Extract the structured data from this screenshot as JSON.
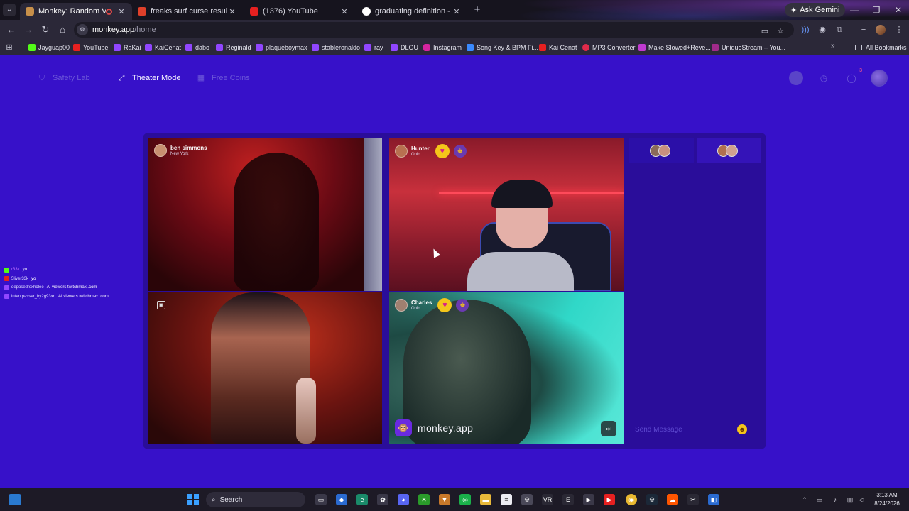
{
  "browser": {
    "tabs": [
      {
        "title": "Monkey: Random Video Ch",
        "active": true
      },
      {
        "title": "freaks surf curse results on Sou",
        "active": false
      },
      {
        "title": "(1376) YouTube",
        "active": false
      },
      {
        "title": "graduating definition - Google",
        "active": false
      }
    ],
    "ask_gemini": "Ask Gemini",
    "url_host": "monkey.app",
    "url_path": "/home",
    "bookmarks": [
      "Jayguap00",
      "YouTube",
      "RaKai",
      "KaiCenat",
      "dabo",
      "Reginald",
      "plaqueboymax",
      "stableronaldo",
      "ray",
      "DLOU",
      "Instagram",
      "Song Key & BPM Fi...",
      "Kai Cenat",
      "MP3 Converter",
      "Make Slowed+Reve...",
      "UniqueStream – You..."
    ],
    "all_bookmarks": "All Bookmarks"
  },
  "page": {
    "nav": {
      "safety_lab": "Safety Lab",
      "theater_mode": "Theater Mode",
      "free_coins": "Free Coins"
    },
    "notifications_badge": "3",
    "tiles": [
      {
        "name": "ben simmons",
        "location": "New York"
      },
      {
        "name": "Hunter",
        "location": "Ohio"
      },
      {
        "name": "",
        "location": ""
      },
      {
        "name": "Charles",
        "location": "Ohio"
      }
    ],
    "brand": "monkey.app",
    "message_placeholder": "Send Message",
    "chat": [
      {
        "user": "r33k",
        "text": "yo"
      },
      {
        "user": "5liver33k",
        "text": "yo"
      },
      {
        "user": "deposedfoxholee",
        "text": "AI viewers twitchmax .com"
      },
      {
        "user": "intentpasser_by2g93xrl",
        "text": "AI viewers twitchmax .com"
      }
    ]
  },
  "taskbar": {
    "search_label": "Search",
    "time": "3:13 AM",
    "date": "8/24/2026"
  },
  "colors": {
    "page_bg": "#3711c9",
    "stage_bg": "#2a0d9a",
    "heart_badge": "#f4c61a",
    "chrome_bg": "#2b2838"
  }
}
